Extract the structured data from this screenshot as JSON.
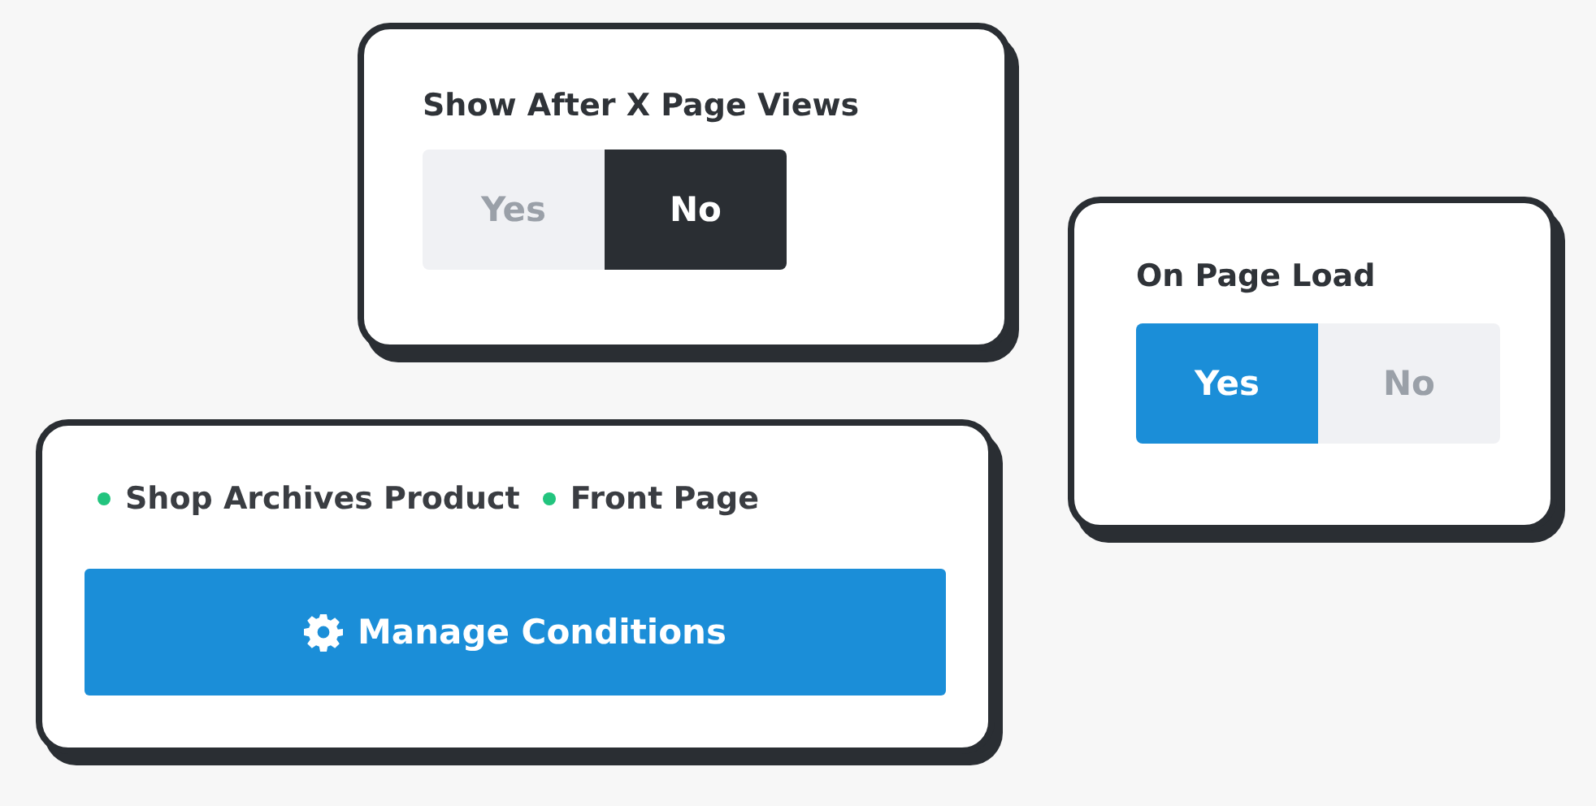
{
  "cards": [
    {
      "kind": "toggle",
      "title": "Show After X Page Views",
      "toggle": {
        "color": "#2a2e33",
        "options": [
          {
            "label": "Yes",
            "selected": false
          },
          {
            "label": "No",
            "selected": true
          }
        ]
      }
    },
    {
      "kind": "toggle",
      "title": "On Page Load",
      "toggle": {
        "color": "#1b8ed8",
        "options": [
          {
            "label": "Yes",
            "selected": true
          },
          {
            "label": "No",
            "selected": false
          }
        ]
      }
    },
    {
      "kind": "conditions",
      "tags": [
        {
          "label": "Shop Archives Product",
          "color": "#22c47e"
        },
        {
          "label": "Front Page",
          "color": "#22c47e"
        }
      ],
      "button": {
        "label": "Manage Conditions"
      }
    }
  ]
}
